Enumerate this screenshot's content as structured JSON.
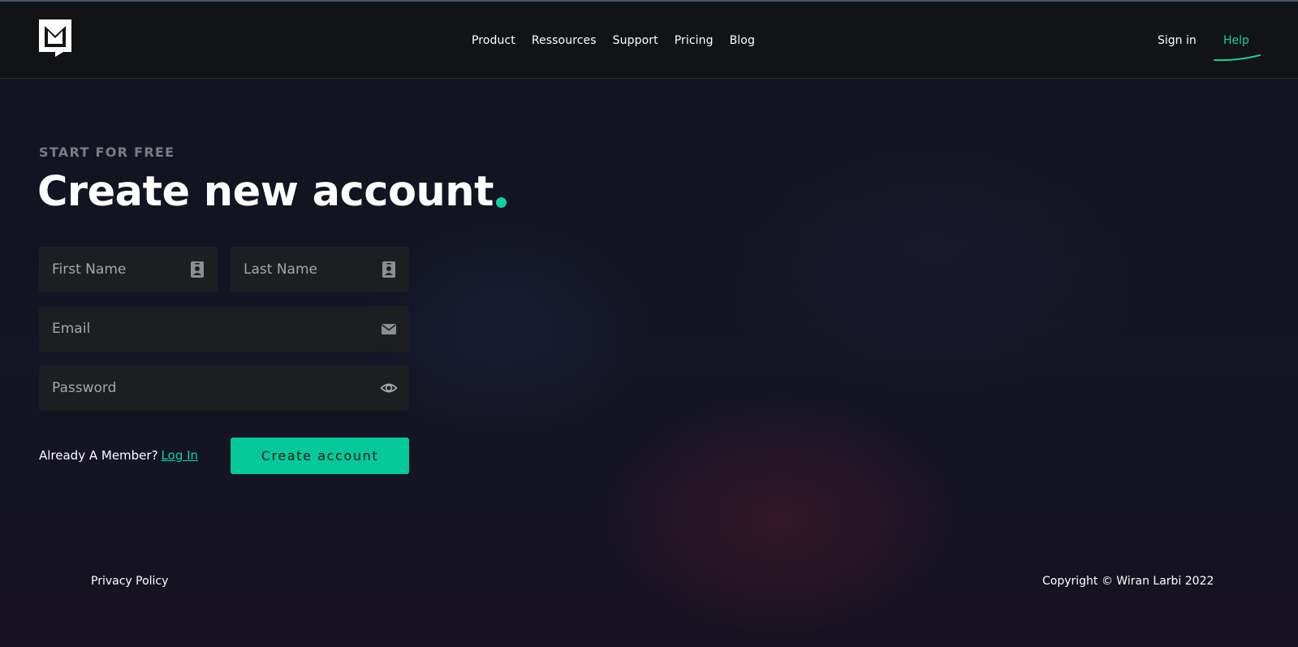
{
  "header": {
    "logo_name": "brand-logo",
    "nav": [
      {
        "label": "Product"
      },
      {
        "label": "Ressources"
      },
      {
        "label": "Support"
      },
      {
        "label": "Pricing"
      },
      {
        "label": "Blog"
      }
    ],
    "sign_in_label": "Sign in",
    "help_label": "Help"
  },
  "hero": {
    "eyebrow": "START FOR FREE",
    "title": "Create new account"
  },
  "form": {
    "first_name": {
      "placeholder": "First Name",
      "value": "",
      "icon": "contact-card-icon"
    },
    "last_name": {
      "placeholder": "Last Name",
      "value": "",
      "icon": "contact-card-icon"
    },
    "email": {
      "placeholder": "Email",
      "value": "",
      "icon": "envelope-icon"
    },
    "password": {
      "placeholder": "Password",
      "value": "",
      "icon": "eye-icon"
    },
    "member_prompt": "Already A Member?",
    "login_link": "Log In",
    "submit_label": "Create account"
  },
  "footer": {
    "privacy_label": "Privacy Policy",
    "copyright": "Copyright © Wiran Larbi 2022"
  },
  "colors": {
    "accent": "#10d39c",
    "button": "#05c99b",
    "header_bg": "#111316",
    "field_bg": "#1d1e21"
  }
}
